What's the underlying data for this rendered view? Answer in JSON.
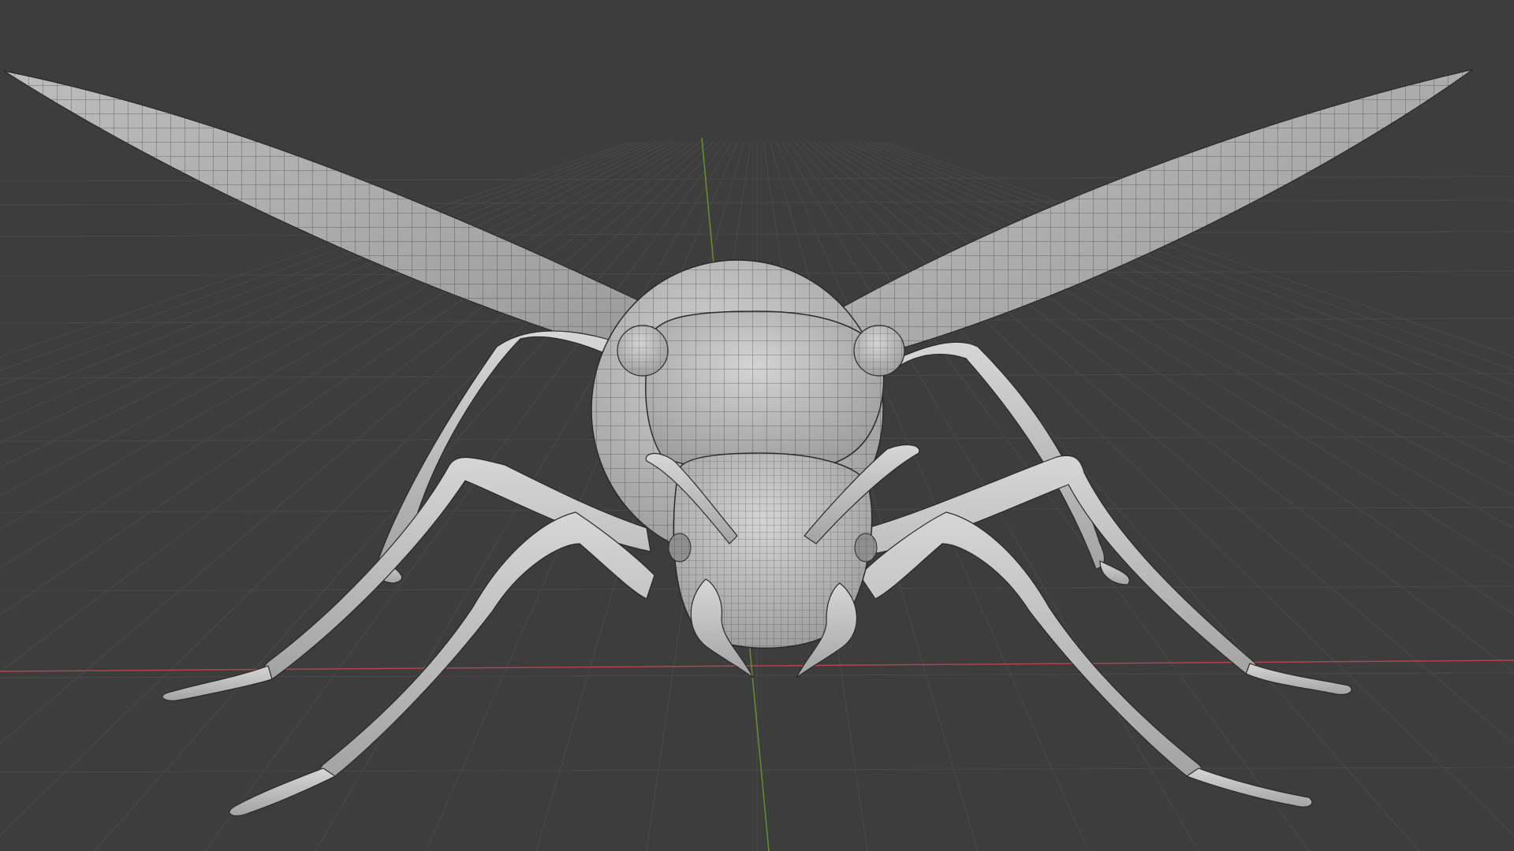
{
  "viewport": {
    "background": "#3d3d3d",
    "grid_color": "#4a4a4a",
    "x_axis_color": "#b2434f",
    "y_axis_color": "#6a8f2a"
  },
  "model": {
    "name": "insect-model",
    "base_color": "#c9c9c9",
    "shade_color": "#a8a8a8",
    "wire_color": "#2a2a2a"
  }
}
